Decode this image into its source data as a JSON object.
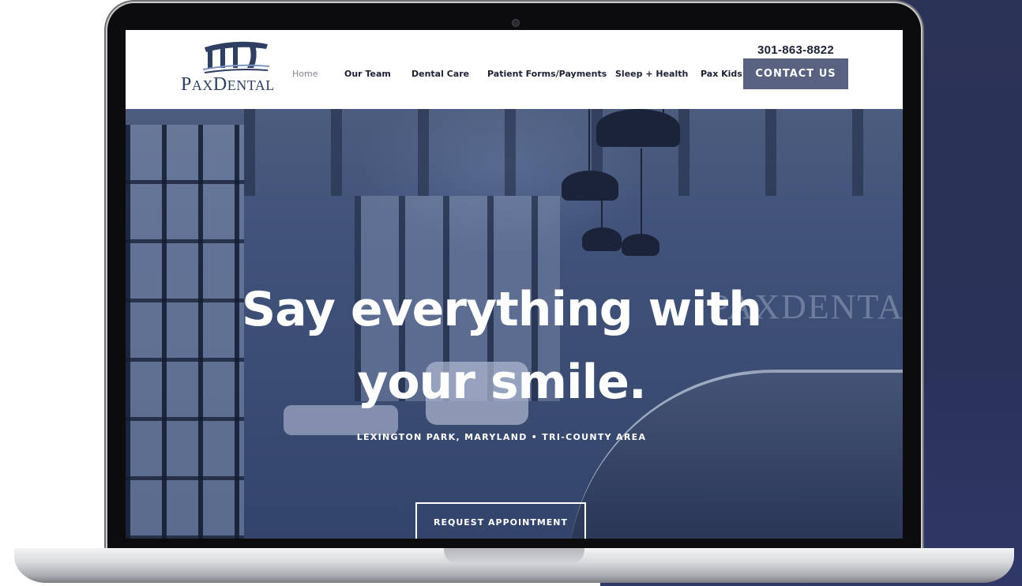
{
  "site": {
    "logo_text_first": "P",
    "logo_text_small1": "AX",
    "logo_text_second": "D",
    "logo_text_small2": "ENTAL",
    "phone": "301-863-8822",
    "contact_label": "CONTACT US",
    "nav": [
      {
        "label": "Home",
        "active": true
      },
      {
        "label": "Our Team"
      },
      {
        "label": "Dental Care"
      },
      {
        "label": "Patient Forms/Payments"
      },
      {
        "label": "Sleep + Health"
      },
      {
        "label": "Pax Kids"
      }
    ]
  },
  "hero": {
    "title_line1": "Say everything with",
    "title_line2": "your smile.",
    "subtitle": "LEXINGTON PARK, MARYLAND  •  TRI-COUNTY AREA",
    "cta_label": "REQUEST APPOINTMENT",
    "wall_sign": "PAXDENTAL"
  },
  "colors": {
    "brand_navy": "#2f3f62",
    "button_slate": "#5a6282",
    "background_panel": "#2b3356"
  }
}
